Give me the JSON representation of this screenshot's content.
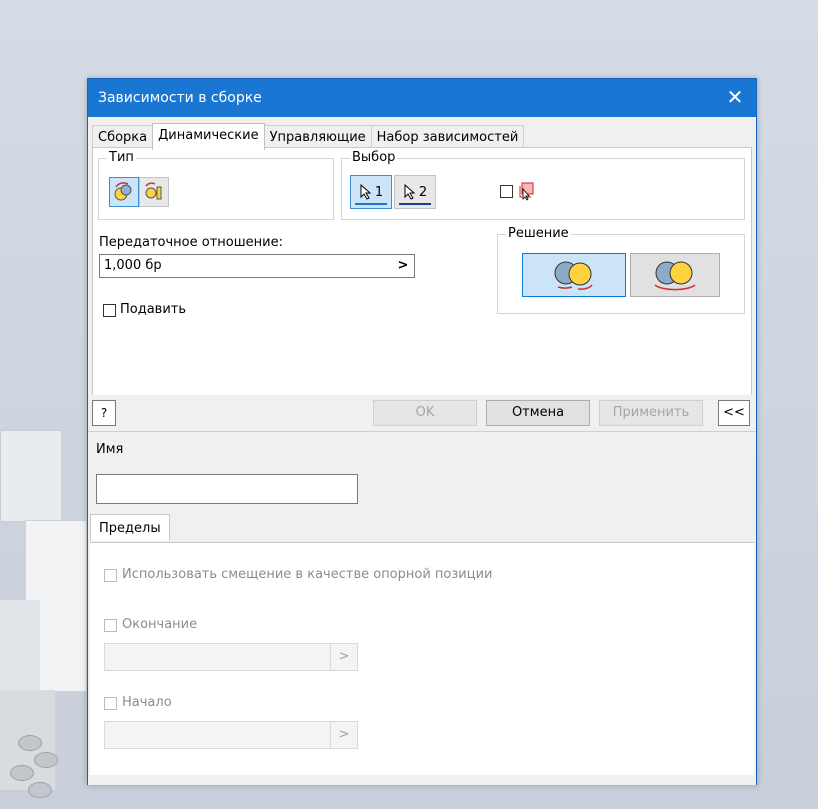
{
  "title": "Зависимости в сборке",
  "tabs": [
    "Сборка",
    "Динамические",
    "Управляющие",
    "Набор зависимостей"
  ],
  "groups": {
    "type": "Тип",
    "selection": "Выбор",
    "solution": "Решение"
  },
  "selection_buttons": [
    "1",
    "2"
  ],
  "ratio_label": "Передаточное отношение:",
  "ratio_value": "1,000 бр",
  "ratio_arrow": ">",
  "suppress_label": "Подавить",
  "buttons": {
    "help": "?",
    "ok": "OK",
    "cancel": "Отмена",
    "apply": "Применить",
    "collapse": "<<"
  },
  "name_label": "Имя",
  "limits_tab": "Пределы",
  "use_offset_label": "Использовать смещение в качестве опорной позиции",
  "end_label": "Окончание",
  "start_label": "Начало",
  "field_arrow": ">",
  "colors": {
    "titlebar": "#1976d2",
    "selected": "#cce4f7",
    "accent": "#0f78d2"
  }
}
